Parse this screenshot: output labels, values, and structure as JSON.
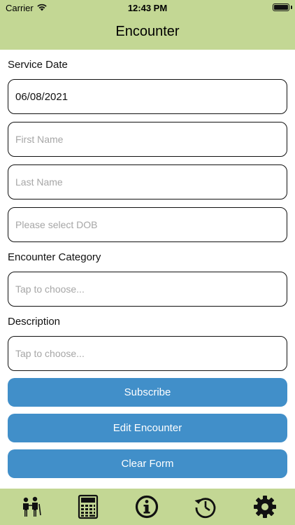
{
  "status_bar": {
    "carrier": "Carrier",
    "time": "12:43 PM"
  },
  "header": {
    "title": "Encounter"
  },
  "form": {
    "service_date_label": "Service Date",
    "service_date_value": "06/08/2021",
    "first_name_placeholder": "First Name",
    "last_name_placeholder": "Last Name",
    "dob_placeholder": "Please select DOB",
    "category_label": "Encounter Category",
    "category_placeholder": "Tap to choose...",
    "description_label": "Description",
    "description_placeholder": "Tap to choose..."
  },
  "buttons": {
    "subscribe": "Subscribe",
    "edit_encounter": "Edit Encounter",
    "clear_form": "Clear Form"
  },
  "tabbar": {
    "icons": [
      "people-icon",
      "calculator-icon",
      "info-icon",
      "history-icon",
      "gear-icon"
    ]
  },
  "colors": {
    "header_bg": "#c3d794",
    "button_bg": "#418fc9",
    "placeholder": "#a6a6a6"
  }
}
